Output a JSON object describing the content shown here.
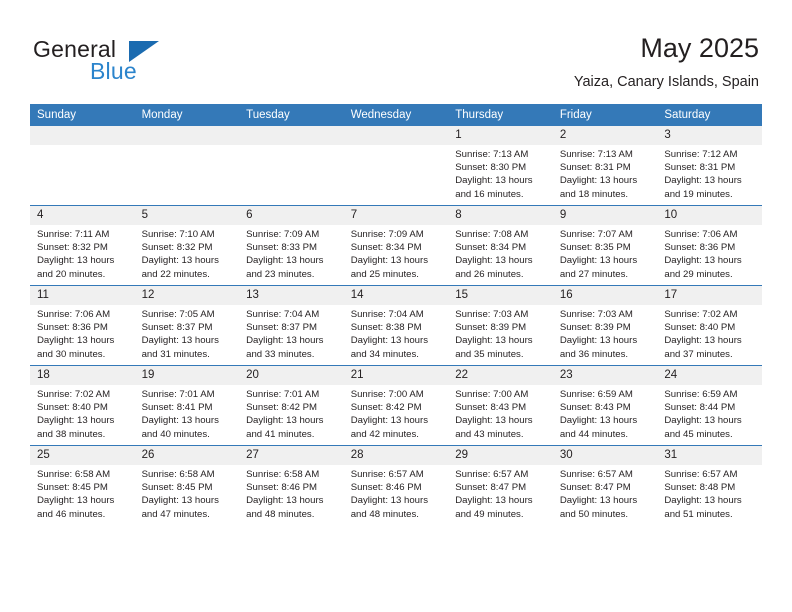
{
  "brand": {
    "name_part1": "General",
    "name_part2": "Blue",
    "triangle_color": "#1b6bb0",
    "blue_color": "#2b84cc"
  },
  "header": {
    "title": "May 2025",
    "subtitle": "Yaiza, Canary Islands, Spain",
    "header_bg_color": "#3479b8",
    "daynum_bg_color": "#f0f0f0"
  },
  "weekday_headers": [
    "Sunday",
    "Monday",
    "Tuesday",
    "Wednesday",
    "Thursday",
    "Friday",
    "Saturday"
  ],
  "labels": {
    "sunrise_prefix": "Sunrise: ",
    "sunset_prefix": "Sunset: ",
    "daylight_prefix": "Daylight: "
  },
  "weeks": [
    [
      {
        "day": "",
        "empty": true
      },
      {
        "day": "",
        "empty": true
      },
      {
        "day": "",
        "empty": true
      },
      {
        "day": "",
        "empty": true
      },
      {
        "day": "1",
        "sunrise": "Sunrise: 7:13 AM",
        "sunset": "Sunset: 8:30 PM",
        "daylight": "Daylight: 13 hours and 16 minutes."
      },
      {
        "day": "2",
        "sunrise": "Sunrise: 7:13 AM",
        "sunset": "Sunset: 8:31 PM",
        "daylight": "Daylight: 13 hours and 18 minutes."
      },
      {
        "day": "3",
        "sunrise": "Sunrise: 7:12 AM",
        "sunset": "Sunset: 8:31 PM",
        "daylight": "Daylight: 13 hours and 19 minutes."
      }
    ],
    [
      {
        "day": "4",
        "sunrise": "Sunrise: 7:11 AM",
        "sunset": "Sunset: 8:32 PM",
        "daylight": "Daylight: 13 hours and 20 minutes."
      },
      {
        "day": "5",
        "sunrise": "Sunrise: 7:10 AM",
        "sunset": "Sunset: 8:32 PM",
        "daylight": "Daylight: 13 hours and 22 minutes."
      },
      {
        "day": "6",
        "sunrise": "Sunrise: 7:09 AM",
        "sunset": "Sunset: 8:33 PM",
        "daylight": "Daylight: 13 hours and 23 minutes."
      },
      {
        "day": "7",
        "sunrise": "Sunrise: 7:09 AM",
        "sunset": "Sunset: 8:34 PM",
        "daylight": "Daylight: 13 hours and 25 minutes."
      },
      {
        "day": "8",
        "sunrise": "Sunrise: 7:08 AM",
        "sunset": "Sunset: 8:34 PM",
        "daylight": "Daylight: 13 hours and 26 minutes."
      },
      {
        "day": "9",
        "sunrise": "Sunrise: 7:07 AM",
        "sunset": "Sunset: 8:35 PM",
        "daylight": "Daylight: 13 hours and 27 minutes."
      },
      {
        "day": "10",
        "sunrise": "Sunrise: 7:06 AM",
        "sunset": "Sunset: 8:36 PM",
        "daylight": "Daylight: 13 hours and 29 minutes."
      }
    ],
    [
      {
        "day": "11",
        "sunrise": "Sunrise: 7:06 AM",
        "sunset": "Sunset: 8:36 PM",
        "daylight": "Daylight: 13 hours and 30 minutes."
      },
      {
        "day": "12",
        "sunrise": "Sunrise: 7:05 AM",
        "sunset": "Sunset: 8:37 PM",
        "daylight": "Daylight: 13 hours and 31 minutes."
      },
      {
        "day": "13",
        "sunrise": "Sunrise: 7:04 AM",
        "sunset": "Sunset: 8:37 PM",
        "daylight": "Daylight: 13 hours and 33 minutes."
      },
      {
        "day": "14",
        "sunrise": "Sunrise: 7:04 AM",
        "sunset": "Sunset: 8:38 PM",
        "daylight": "Daylight: 13 hours and 34 minutes."
      },
      {
        "day": "15",
        "sunrise": "Sunrise: 7:03 AM",
        "sunset": "Sunset: 8:39 PM",
        "daylight": "Daylight: 13 hours and 35 minutes."
      },
      {
        "day": "16",
        "sunrise": "Sunrise: 7:03 AM",
        "sunset": "Sunset: 8:39 PM",
        "daylight": "Daylight: 13 hours and 36 minutes."
      },
      {
        "day": "17",
        "sunrise": "Sunrise: 7:02 AM",
        "sunset": "Sunset: 8:40 PM",
        "daylight": "Daylight: 13 hours and 37 minutes."
      }
    ],
    [
      {
        "day": "18",
        "sunrise": "Sunrise: 7:02 AM",
        "sunset": "Sunset: 8:40 PM",
        "daylight": "Daylight: 13 hours and 38 minutes."
      },
      {
        "day": "19",
        "sunrise": "Sunrise: 7:01 AM",
        "sunset": "Sunset: 8:41 PM",
        "daylight": "Daylight: 13 hours and 40 minutes."
      },
      {
        "day": "20",
        "sunrise": "Sunrise: 7:01 AM",
        "sunset": "Sunset: 8:42 PM",
        "daylight": "Daylight: 13 hours and 41 minutes."
      },
      {
        "day": "21",
        "sunrise": "Sunrise: 7:00 AM",
        "sunset": "Sunset: 8:42 PM",
        "daylight": "Daylight: 13 hours and 42 minutes."
      },
      {
        "day": "22",
        "sunrise": "Sunrise: 7:00 AM",
        "sunset": "Sunset: 8:43 PM",
        "daylight": "Daylight: 13 hours and 43 minutes."
      },
      {
        "day": "23",
        "sunrise": "Sunrise: 6:59 AM",
        "sunset": "Sunset: 8:43 PM",
        "daylight": "Daylight: 13 hours and 44 minutes."
      },
      {
        "day": "24",
        "sunrise": "Sunrise: 6:59 AM",
        "sunset": "Sunset: 8:44 PM",
        "daylight": "Daylight: 13 hours and 45 minutes."
      }
    ],
    [
      {
        "day": "25",
        "sunrise": "Sunrise: 6:58 AM",
        "sunset": "Sunset: 8:45 PM",
        "daylight": "Daylight: 13 hours and 46 minutes."
      },
      {
        "day": "26",
        "sunrise": "Sunrise: 6:58 AM",
        "sunset": "Sunset: 8:45 PM",
        "daylight": "Daylight: 13 hours and 47 minutes."
      },
      {
        "day": "27",
        "sunrise": "Sunrise: 6:58 AM",
        "sunset": "Sunset: 8:46 PM",
        "daylight": "Daylight: 13 hours and 48 minutes."
      },
      {
        "day": "28",
        "sunrise": "Sunrise: 6:57 AM",
        "sunset": "Sunset: 8:46 PM",
        "daylight": "Daylight: 13 hours and 48 minutes."
      },
      {
        "day": "29",
        "sunrise": "Sunrise: 6:57 AM",
        "sunset": "Sunset: 8:47 PM",
        "daylight": "Daylight: 13 hours and 49 minutes."
      },
      {
        "day": "30",
        "sunrise": "Sunrise: 6:57 AM",
        "sunset": "Sunset: 8:47 PM",
        "daylight": "Daylight: 13 hours and 50 minutes."
      },
      {
        "day": "31",
        "sunrise": "Sunrise: 6:57 AM",
        "sunset": "Sunset: 8:48 PM",
        "daylight": "Daylight: 13 hours and 51 minutes."
      }
    ]
  ]
}
